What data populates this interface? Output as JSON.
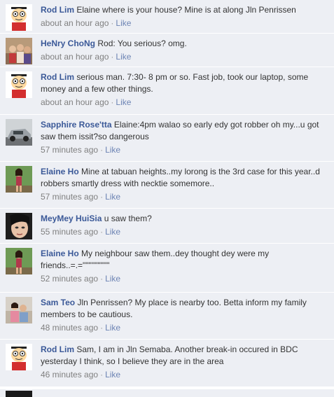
{
  "colors": {
    "row_bg": "#edeff4",
    "author": "#3b5998",
    "meta": "#808080",
    "like": "#6d84b4"
  },
  "comments": [
    {
      "author": "Rod Lim",
      "text": "Elaine where is your house? Mine is at along Jln Penrissen",
      "time": "about an hour ago",
      "like": "Like",
      "avatar_icon": "cartoon-face-avatar-icon"
    },
    {
      "author": "HeNry ChoNg",
      "text": "Rod: You serious? omg.",
      "time": "about an hour ago",
      "like": "Like",
      "avatar_icon": "group-photo-avatar-icon"
    },
    {
      "author": "Rod Lim",
      "text": "serious man. 7:30- 8 pm or so. Fast job, took our laptop, some money and a few other things.",
      "time": "about an hour ago",
      "like": "Like",
      "avatar_icon": "cartoon-face-avatar-icon"
    },
    {
      "author": "Sapphire Rose'tta",
      "text": "Elaine:4pm walao so early edy got robber oh my...u got saw them issit?so dangerous",
      "time": "57 minutes ago",
      "like": "Like",
      "avatar_icon": "car-photo-avatar-icon"
    },
    {
      "author": "Elaine Ho",
      "text": "Mine at tabuan heights..my lorong is the 3rd case for this year..d robbers smartly dress with necktie somemore..",
      "time": "57 minutes ago",
      "like": "Like",
      "avatar_icon": "person-photo-avatar-icon"
    },
    {
      "author": "MeyMey HuiSia",
      "text": "u saw them?",
      "time": "55 minutes ago",
      "like": "Like",
      "avatar_icon": "face-photo-avatar-icon"
    },
    {
      "author": "Elaine Ho",
      "text": "My neighbour saw them..dey thought dey were my friends..=.=\"\"\"\"\"\"\"\"\"",
      "time": "52 minutes ago",
      "like": "Like",
      "avatar_icon": "person-photo-avatar-icon"
    },
    {
      "author": "Sam Teo",
      "text": "Jln Penrissen? My place is nearby too. Betta inform my family members to be cautious.",
      "time": "48 minutes ago",
      "like": "Like",
      "avatar_icon": "group-photo-avatar-icon"
    },
    {
      "author": "Rod Lim",
      "text": "Sam, I am in Jln Semaba. Another break-in occured in BDC yesterday I think, so I believe they are in the area",
      "time": "46 minutes ago",
      "like": "Like",
      "avatar_icon": "cartoon-face-avatar-icon"
    }
  ]
}
